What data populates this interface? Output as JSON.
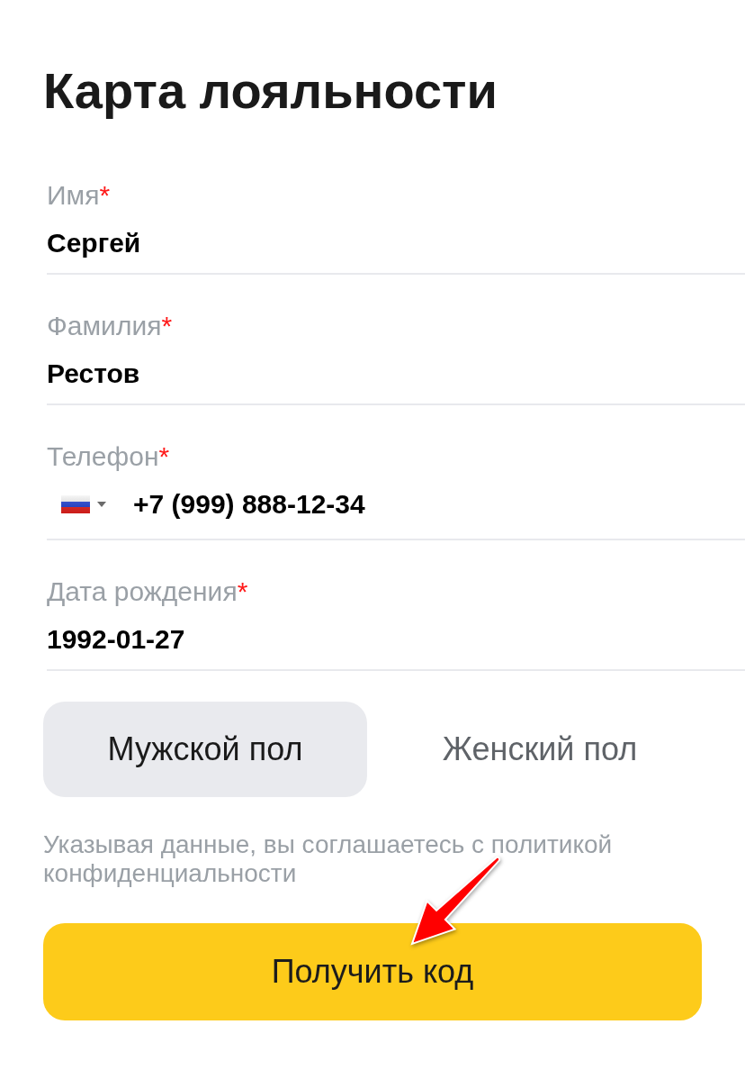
{
  "title": "Карта лояльности",
  "fields": [
    {
      "kind": "text",
      "label": "Имя",
      "required_mark": "*",
      "value": "Сергей"
    },
    {
      "kind": "text",
      "label": "Фамилия",
      "required_mark": "*",
      "value": "Рестов"
    },
    {
      "kind": "phone",
      "label": "Телефон",
      "required_mark": "*",
      "value": "+7 (999) 888-12-34"
    },
    {
      "kind": "text",
      "label": "Дата рождения",
      "required_mark": "*",
      "value": "1992-01-27"
    }
  ],
  "gender": [
    {
      "label": "Мужской пол",
      "selected": true
    },
    {
      "label": "Женский пол",
      "selected": false
    }
  ],
  "consent": "Указывая данные, вы соглашаетесь с политикой конфиденциальности",
  "submit": "Получить код",
  "annotation": {
    "kind": "arrow"
  }
}
